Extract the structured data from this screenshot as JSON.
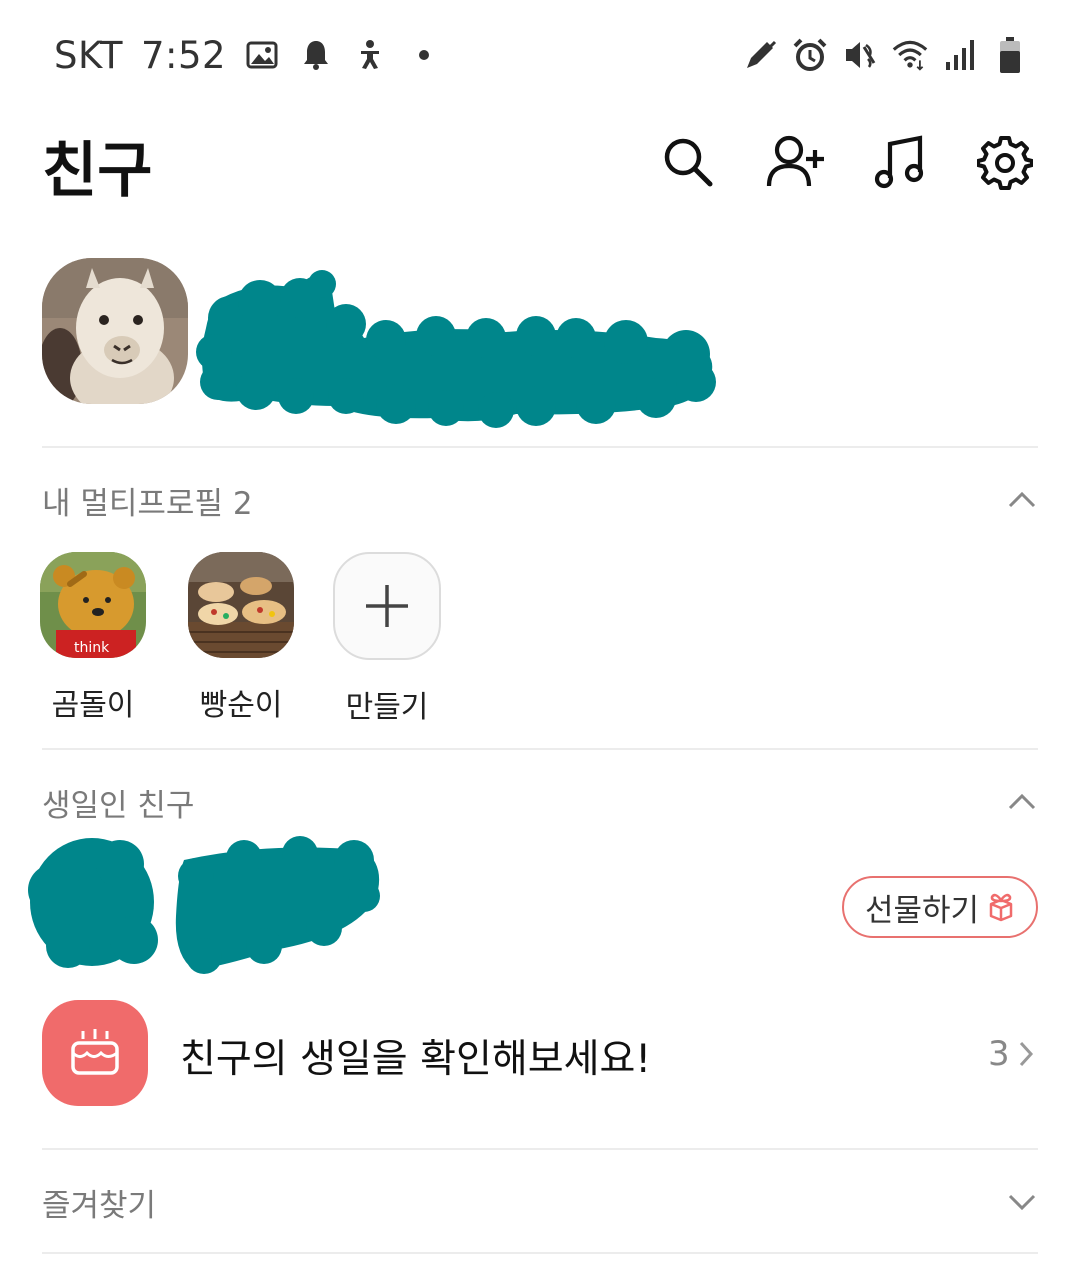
{
  "status_bar": {
    "carrier": "SKT",
    "time": "7:52",
    "left_icons": [
      "gallery-icon",
      "bell-icon",
      "accessibility-icon",
      "dot-icon"
    ],
    "right_icons": [
      "s-pen-icon",
      "alarm-icon",
      "mute-icon",
      "wifi-icon",
      "signal-icon",
      "battery-icon"
    ]
  },
  "header": {
    "title": "친구",
    "actions": [
      "search-icon",
      "add-friend-icon",
      "music-icon",
      "settings-icon"
    ]
  },
  "my_profile": {
    "avatar": "alpaca-photo",
    "name_redacted": true,
    "redaction_color": "#00868b"
  },
  "multi_profile": {
    "label": "내 멀티프로필 2",
    "items": [
      {
        "label": "곰돌이",
        "image": "pooh-think"
      },
      {
        "label": "빵순이",
        "image": "bread-photo"
      },
      {
        "label": "만들기",
        "image": "plus-icon"
      }
    ]
  },
  "birthday": {
    "label": "생일인 친구",
    "gift_button": "선물하기",
    "prompt": "친구의 생일을 확인해보세요!",
    "count": "3",
    "accent": "#f06b6b"
  },
  "favorites": {
    "label": "즐겨찾기"
  }
}
